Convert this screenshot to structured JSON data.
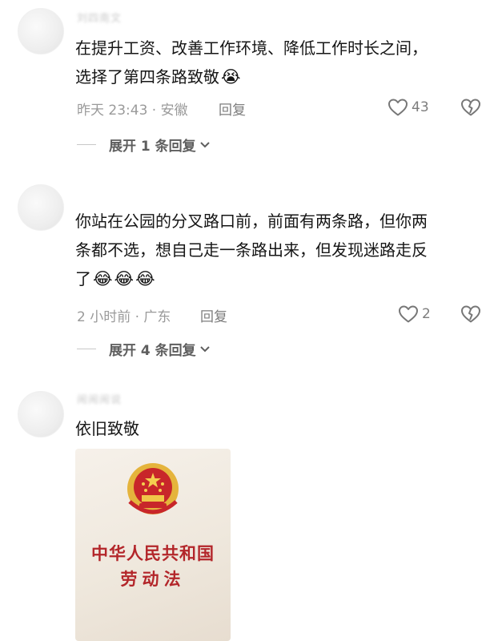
{
  "comments": [
    {
      "username": "刘四南文",
      "lines": [
        "在提升工资、改善工作环境、降低工作时长之间，",
        "选择了第四条路致敬"
      ],
      "trailing_emojis": [
        "😭"
      ],
      "time_location": "昨天 23:43 · 安徽",
      "reply_label": "回复",
      "like_count": "43",
      "expand_label": "展开 1 条回复"
    },
    {
      "username": "",
      "lines": [
        "你站在公园的分叉路口前，前面有两条路，但你两",
        "条都不选，想自己走一条路出来，但发现迷路走反",
        "了"
      ],
      "trailing_emojis": [
        "😂",
        "😂",
        "😂"
      ],
      "time_location": "2 小时前 · 广东",
      "reply_label": "回复",
      "like_count": "2",
      "expand_label": "展开 4 条回复"
    },
    {
      "username": "闹闹闹说",
      "lines": [
        "依旧致敬"
      ],
      "trailing_emojis": [],
      "attachment": {
        "title_line1": "中华人民共和国",
        "title_line2": "劳动法",
        "emblem": "national-emblem"
      }
    }
  ],
  "icons": {
    "like": "heart-outline-icon",
    "dislike": "broken-heart-icon",
    "expand": "chevron-down-icon"
  },
  "colors": {
    "text": "#161616",
    "meta": "#9a9a9a",
    "emblem_red": "#c8262a",
    "emblem_gold": "#e5b43c"
  }
}
